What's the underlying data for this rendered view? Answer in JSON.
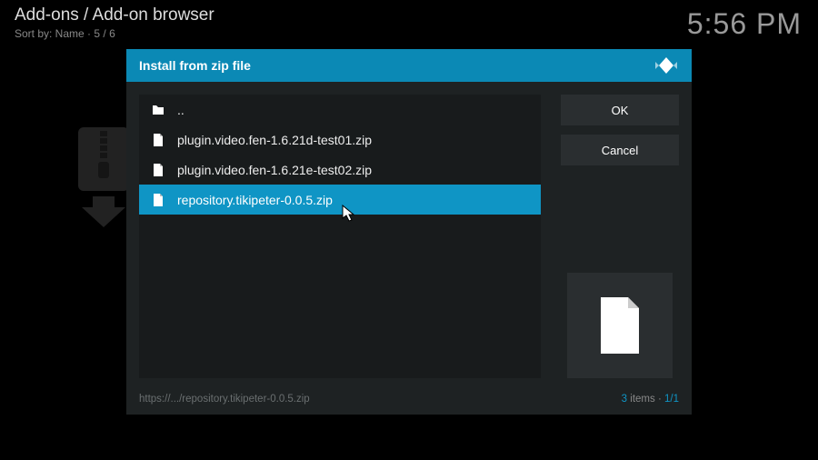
{
  "header": {
    "title": "Add-ons / Add-on browser",
    "sort_label": "Sort by: Name",
    "sort_count": "5 / 6"
  },
  "clock": "5:56 PM",
  "dialog": {
    "title": "Install from zip file",
    "ok_label": "OK",
    "cancel_label": "Cancel",
    "files": [
      {
        "name": "..",
        "type": "folder",
        "selected": false
      },
      {
        "name": "plugin.video.fen-1.6.21d-test01.zip",
        "type": "file",
        "selected": false
      },
      {
        "name": "plugin.video.fen-1.6.21e-test02.zip",
        "type": "file",
        "selected": false
      },
      {
        "name": "repository.tikipeter-0.0.5.zip",
        "type": "file",
        "selected": true
      }
    ],
    "footer_path": "https://.../repository.tikipeter-0.0.5.zip",
    "footer_items_count": "3",
    "footer_items_label": "items",
    "footer_page": "1/1"
  }
}
